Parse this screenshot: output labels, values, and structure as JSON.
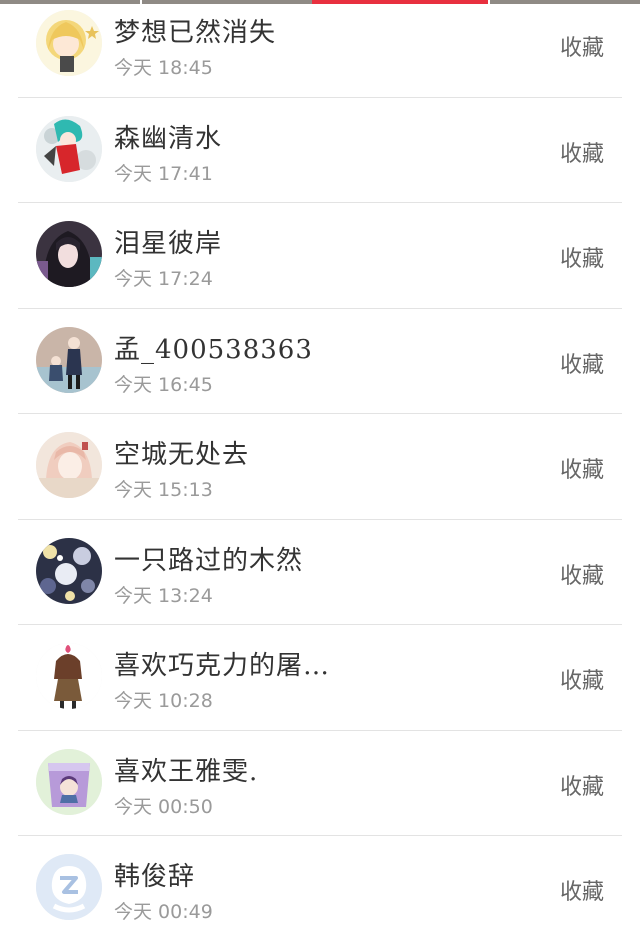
{
  "colors": {
    "accent": "#e8303f",
    "name_text": "#333333",
    "time_text": "#9a9a9a",
    "divider": "#e3e3e3"
  },
  "users": [
    {
      "name": "梦想已然消失",
      "time": "今天 18:45",
      "action": "收藏",
      "avatar": "anime-girl-blonde-avatar"
    },
    {
      "name": "森幽清水",
      "time": "今天 17:41",
      "action": "收藏",
      "avatar": "anime-teal-hair-avatar"
    },
    {
      "name": "泪星彼岸",
      "time": "今天 17:24",
      "action": "收藏",
      "avatar": "anime-dark-hair-avatar"
    },
    {
      "name": "孟_400538363",
      "time": "今天 16:45",
      "action": "收藏",
      "avatar": "anime-two-figures-avatar"
    },
    {
      "name": "空城无处去",
      "time": "今天 15:13",
      "action": "收藏",
      "avatar": "anime-pink-girl-avatar"
    },
    {
      "name": "一只路过的木然",
      "time": "今天 13:24",
      "action": "收藏",
      "avatar": "starry-pattern-avatar"
    },
    {
      "name": "喜欢巧克力的屠…",
      "time": "今天 10:28",
      "action": "收藏",
      "avatar": "chibi-girl-avatar"
    },
    {
      "name": "喜欢王雅雯.",
      "time": "今天 00:50",
      "action": "收藏",
      "avatar": "purple-cup-avatar"
    },
    {
      "name": "韩俊辞",
      "time": "今天 00:49",
      "action": "收藏",
      "avatar": "default-qq-avatar"
    }
  ]
}
